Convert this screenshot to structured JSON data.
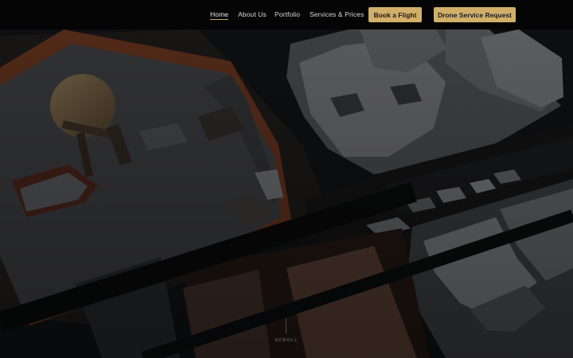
{
  "nav": {
    "items": [
      {
        "label": "Home",
        "active": true
      },
      {
        "label": "About Us",
        "active": false
      },
      {
        "label": "Portfolio",
        "active": false
      },
      {
        "label": "Services & Prices",
        "active": false
      }
    ],
    "cta": {
      "book_label": "Book a Flight",
      "request_label": "Drone Service Request"
    }
  },
  "hero": {
    "scroll_label": "SCROLL"
  },
  "colors": {
    "accent": "#d2b06a",
    "nav_background": "#050505"
  }
}
